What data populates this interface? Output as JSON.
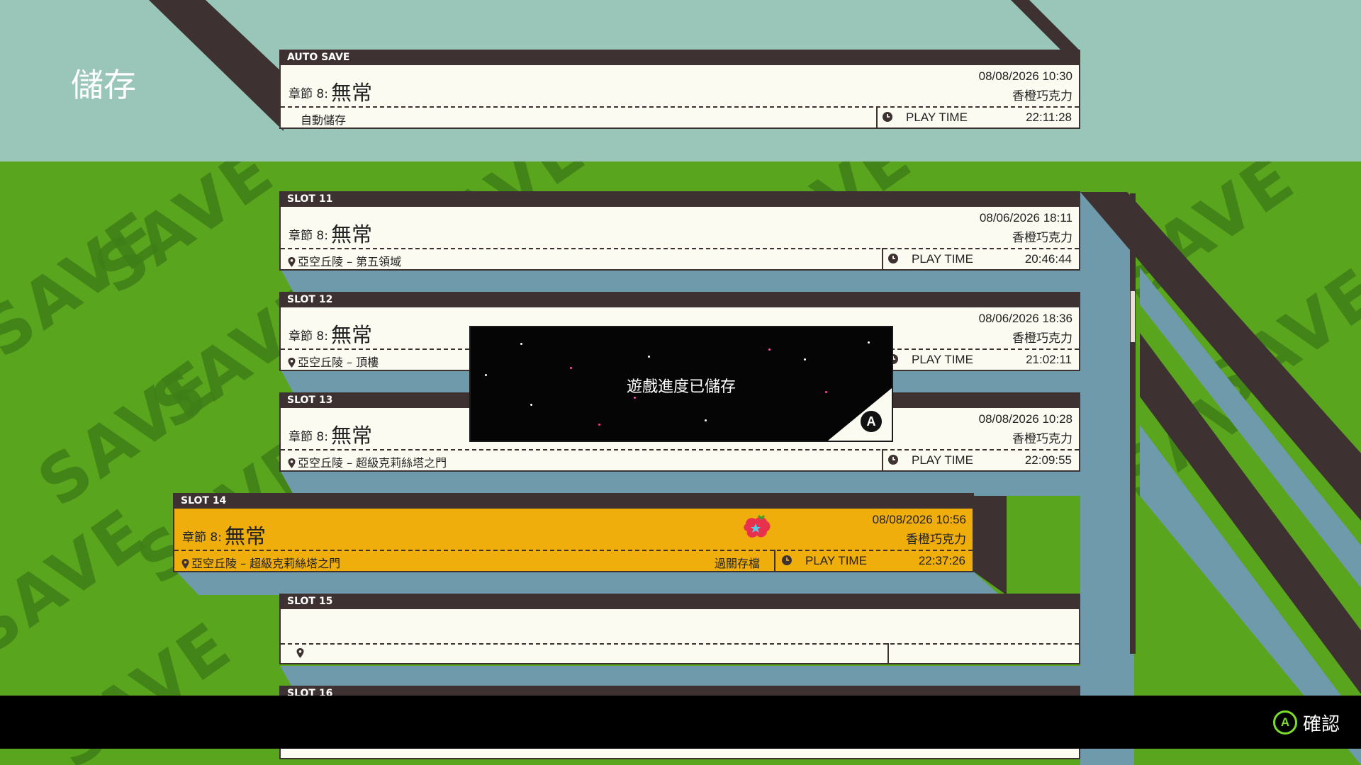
{
  "screen": {
    "title": "儲存"
  },
  "background": {
    "pattern_text": "SAVE",
    "colors": {
      "top": "#99c6b8",
      "green": "#5aa51e",
      "frame": "#3d3231",
      "card": "#fbfbf1",
      "highlight": "#f0ae0d"
    }
  },
  "slots": [
    {
      "header": "AUTO SAVE",
      "chapter_prefix": "章節 8:",
      "chapter_name": "無常",
      "date": "08/08/2026 10:30",
      "owner": "香橙巧克力",
      "location": "自動儲存",
      "play_time_label": "PLAY TIME",
      "play_time": "22:11:28"
    },
    {
      "header": "SLOT 11",
      "chapter_prefix": "章節 8:",
      "chapter_name": "無常",
      "date": "08/06/2026 18:11",
      "owner": "香橙巧克力",
      "location": "亞空丘陵 – 第五領域",
      "play_time_label": "PLAY TIME",
      "play_time": "20:46:44"
    },
    {
      "header": "SLOT 12",
      "chapter_prefix": "章節 8:",
      "chapter_name": "無常",
      "date": "08/06/2026 18:36",
      "owner": "香橙巧克力",
      "location": "亞空丘陵 – 頂樓",
      "play_time_label": "PLAY TIME",
      "play_time": "21:02:11"
    },
    {
      "header": "SLOT 13",
      "chapter_prefix": "章節 8:",
      "chapter_name": "無常",
      "date": "08/08/2026 10:28",
      "owner": "香橙巧克力",
      "location": "亞空丘陵 – 超級克莉絲塔之門",
      "play_time_label": "PLAY TIME",
      "play_time": "22:09:55"
    },
    {
      "header": "SLOT 14",
      "chapter_prefix": "章節 8:",
      "chapter_name": "無常",
      "date": "08/08/2026 10:56",
      "owner": "香橙巧克力",
      "location": "亞空丘陵 – 超級克莉絲塔之門",
      "tag": "過關存檔",
      "play_time_label": "PLAY TIME",
      "play_time": "22:37:26",
      "selected": true
    },
    {
      "header": "SLOT 15"
    },
    {
      "header": "SLOT 16"
    }
  ],
  "notice": {
    "message": "遊戲進度已儲存",
    "button": "A"
  },
  "footer": {
    "confirm_button": "A",
    "confirm_label": "確認"
  }
}
